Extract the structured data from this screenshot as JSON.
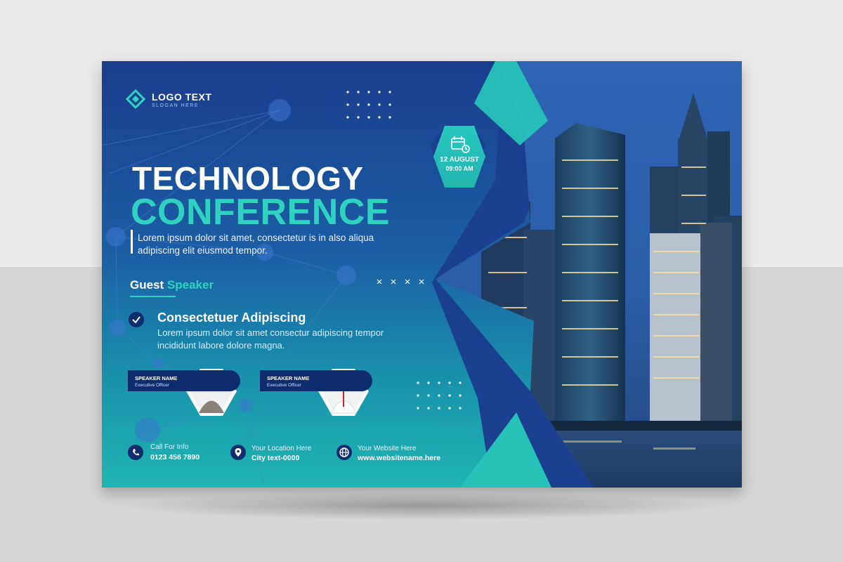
{
  "logo": {
    "text": "LOGO TEXT",
    "slogan": "SLOGAN HERE"
  },
  "title": {
    "line1": "TECHNOLOGY",
    "line2": "CONFERENCE"
  },
  "description": "Lorem ipsum dolor sit amet, consectetur is in also aliqua adipiscing elit eiusmod tempor.",
  "event": {
    "date": "12 AUGUST",
    "time": "09:00 AM"
  },
  "guest_speaker": {
    "label_part1": "Guest",
    "label_part2": "Speaker"
  },
  "feature": {
    "title": "Consectetuer Adipiscing",
    "text": "Lorem ipsum dolor sit amet consectur adipiscing tempor incididunt labore dolore magna."
  },
  "speakers": [
    {
      "name": "SPEAKER NAME",
      "role": "Executive Officer"
    },
    {
      "name": "SPEAKER NAME",
      "role": "Executive Officer"
    }
  ],
  "contacts": {
    "phone": {
      "label": "Call For Info",
      "value": "0123 456 7890"
    },
    "location": {
      "label": "Your Location Here",
      "value": "City text-0000"
    },
    "website": {
      "label": "Your Website Here",
      "value": "www.websitename.here"
    }
  },
  "colors": {
    "navy": "#0f2c6e",
    "blue": "#1b5ea5",
    "teal": "#2fd1c1",
    "background": "#dcdcdc"
  },
  "icons": [
    "logo-diamond-icon",
    "calendar-clock-icon",
    "checkmark-icon",
    "phone-icon",
    "location-pin-icon",
    "globe-icon"
  ]
}
